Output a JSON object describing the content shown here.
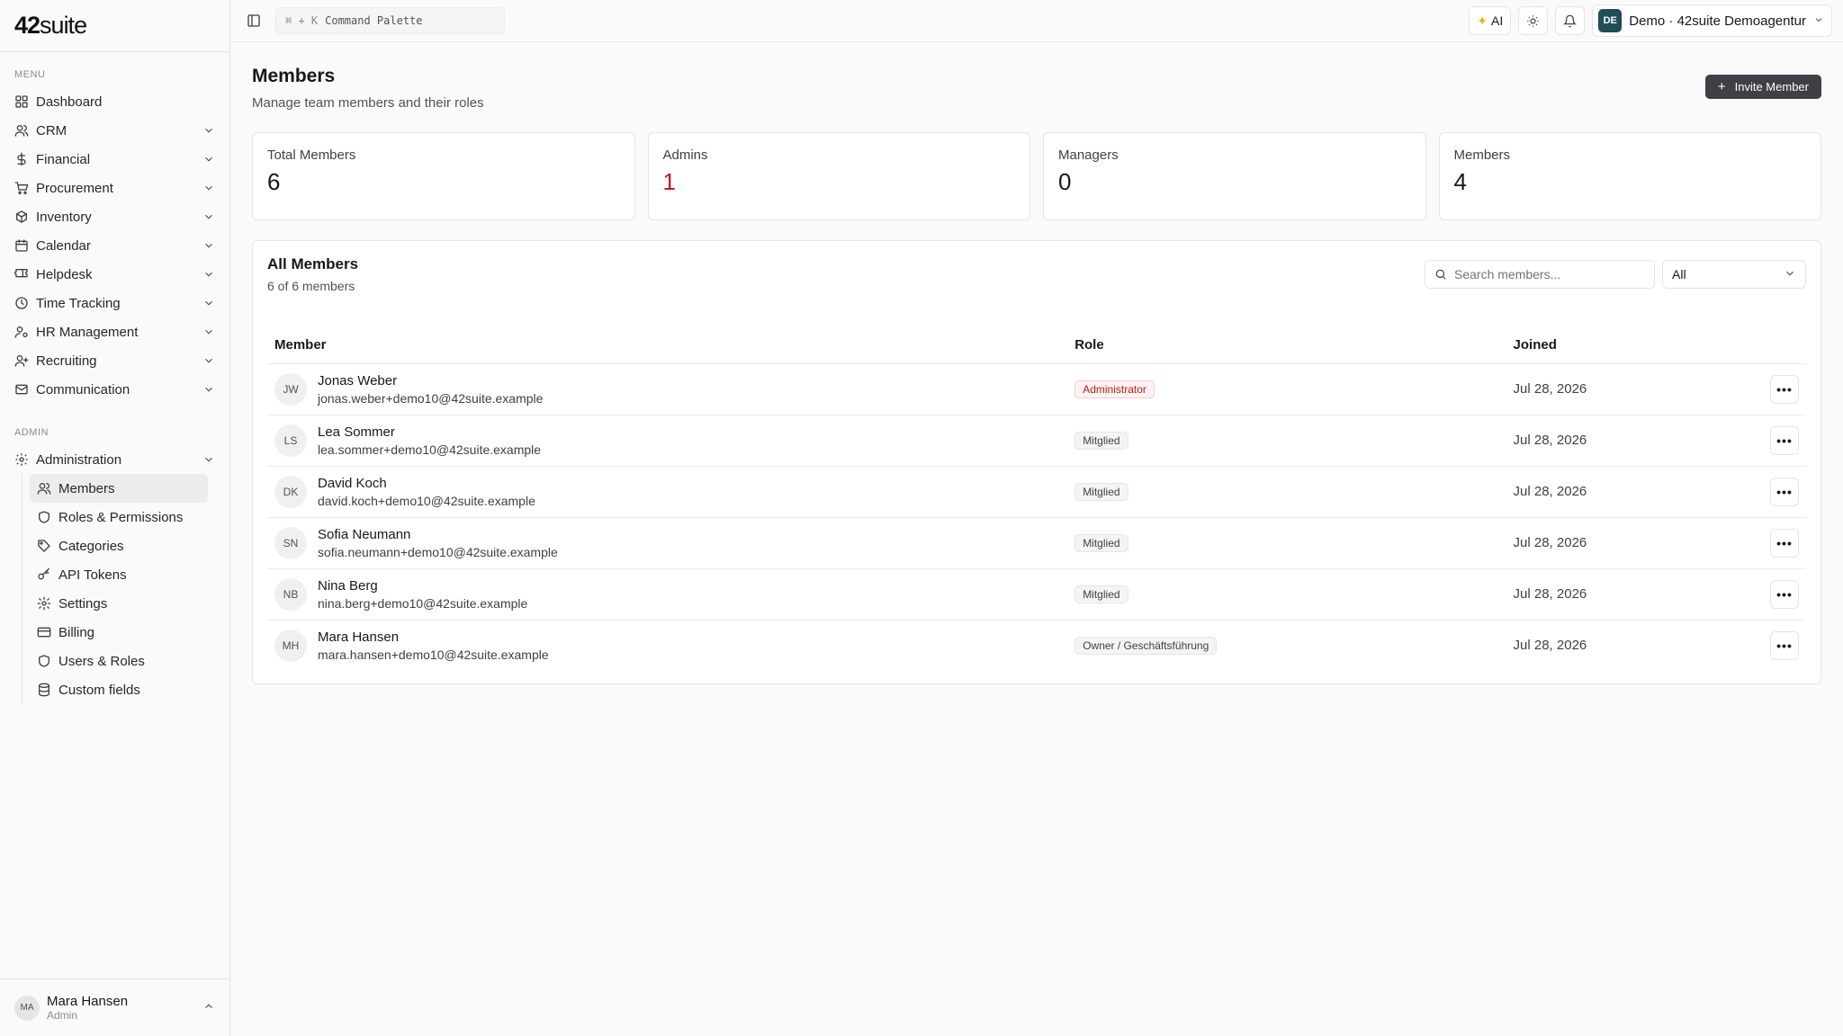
{
  "brand": {
    "logo_main": "42",
    "logo_rest": "suite"
  },
  "sidebar": {
    "menu_label": "MENU",
    "items": [
      {
        "label": "Dashboard",
        "icon": "dashboard-icon",
        "expandable": false
      },
      {
        "label": "CRM",
        "icon": "users-icon",
        "expandable": true
      },
      {
        "label": "Financial",
        "icon": "dollar-icon",
        "expandable": true
      },
      {
        "label": "Procurement",
        "icon": "cart-icon",
        "expandable": true
      },
      {
        "label": "Inventory",
        "icon": "boxes-icon",
        "expandable": true
      },
      {
        "label": "Calendar",
        "icon": "calendar-icon",
        "expandable": true
      },
      {
        "label": "Helpdesk",
        "icon": "ticket-icon",
        "expandable": true
      },
      {
        "label": "Time Tracking",
        "icon": "clock-icon",
        "expandable": true
      },
      {
        "label": "HR Management",
        "icon": "user-cog-icon",
        "expandable": true
      },
      {
        "label": "Recruiting",
        "icon": "user-plus-icon",
        "expandable": true
      },
      {
        "label": "Communication",
        "icon": "mail-icon",
        "expandable": true
      }
    ],
    "admin_label": "ADMIN",
    "admin_item": {
      "label": "Administration",
      "icon": "gear-icon"
    },
    "admin_sub": [
      {
        "label": "Members",
        "icon": "users-icon",
        "active": true
      },
      {
        "label": "Roles & Permissions",
        "icon": "shield-icon",
        "active": false
      },
      {
        "label": "Categories",
        "icon": "tag-icon",
        "active": false
      },
      {
        "label": "API Tokens",
        "icon": "key-icon",
        "active": false
      },
      {
        "label": "Settings",
        "icon": "gear-icon",
        "active": false
      },
      {
        "label": "Billing",
        "icon": "credit-card-icon",
        "active": false
      },
      {
        "label": "Users & Roles",
        "icon": "shield-icon",
        "active": false
      },
      {
        "label": "Custom fields",
        "icon": "database-icon",
        "active": false
      }
    ],
    "user": {
      "initials": "MA",
      "name": "Mara Hansen",
      "role": "Admin"
    }
  },
  "topbar": {
    "command_kbd": "⌘ + K",
    "command_label": "Command Palette",
    "ai_label": "AI",
    "org_initials": "DE",
    "org_name": "Demo · 42suite Demoagentur"
  },
  "page": {
    "title": "Members",
    "subtitle": "Manage team members and their roles",
    "invite_label": "Invite Member"
  },
  "stats": [
    {
      "label": "Total Members",
      "value": "6",
      "highlight": false
    },
    {
      "label": "Admins",
      "value": "1",
      "highlight": true
    },
    {
      "label": "Managers",
      "value": "0",
      "highlight": false
    },
    {
      "label": "Members",
      "value": "4",
      "highlight": false
    }
  ],
  "panel": {
    "title": "All Members",
    "count": "6 of 6 members",
    "search_placeholder": "Search members...",
    "filter_value": "All",
    "columns": {
      "member": "Member",
      "role": "Role",
      "joined": "Joined"
    }
  },
  "members": [
    {
      "initials": "JW",
      "name": "Jonas Weber",
      "email": "jonas.weber+demo10@42suite.example",
      "role": "Administrator",
      "role_type": "admin",
      "joined": "Jul 28, 2026"
    },
    {
      "initials": "LS",
      "name": "Lea Sommer",
      "email": "lea.sommer+demo10@42suite.example",
      "role": "Mitglied",
      "role_type": "member",
      "joined": "Jul 28, 2026"
    },
    {
      "initials": "DK",
      "name": "David Koch",
      "email": "david.koch+demo10@42suite.example",
      "role": "Mitglied",
      "role_type": "member",
      "joined": "Jul 28, 2026"
    },
    {
      "initials": "SN",
      "name": "Sofia Neumann",
      "email": "sofia.neumann+demo10@42suite.example",
      "role": "Mitglied",
      "role_type": "member",
      "joined": "Jul 28, 2026"
    },
    {
      "initials": "NB",
      "name": "Nina Berg",
      "email": "nina.berg+demo10@42suite.example",
      "role": "Mitglied",
      "role_type": "member",
      "joined": "Jul 28, 2026"
    },
    {
      "initials": "MH",
      "name": "Mara Hansen",
      "email": "mara.hansen+demo10@42suite.example",
      "role": "Owner / Geschäftsführung",
      "role_type": "owner",
      "joined": "Jul 28, 2026"
    }
  ],
  "colors": {
    "accent_dark": "#3f3f46",
    "admin_red": "#b91c1c",
    "org_badge": "#1e4f55"
  }
}
